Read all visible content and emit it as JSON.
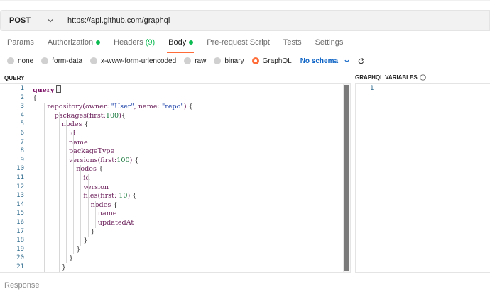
{
  "request": {
    "method": "POST",
    "url": "https://api.github.com/graphql"
  },
  "tabs": [
    {
      "label": "Params",
      "active": false,
      "dot": false,
      "count": ""
    },
    {
      "label": "Authorization",
      "active": false,
      "dot": true,
      "count": ""
    },
    {
      "label": "Headers",
      "active": false,
      "dot": false,
      "count": "(9)"
    },
    {
      "label": "Body",
      "active": true,
      "dot": true,
      "count": ""
    },
    {
      "label": "Pre-request Script",
      "active": false,
      "dot": false,
      "count": ""
    },
    {
      "label": "Tests",
      "active": false,
      "dot": false,
      "count": ""
    },
    {
      "label": "Settings",
      "active": false,
      "dot": false,
      "count": ""
    }
  ],
  "body_types": [
    {
      "label": "none",
      "selected": false
    },
    {
      "label": "form-data",
      "selected": false
    },
    {
      "label": "x-www-form-urlencoded",
      "selected": false
    },
    {
      "label": "raw",
      "selected": false
    },
    {
      "label": "binary",
      "selected": false
    },
    {
      "label": "GraphQL",
      "selected": true
    }
  ],
  "schema_label": "No schema",
  "query_panel": {
    "label": "QUERY",
    "lines": [
      {
        "n": "1",
        "indent": 0,
        "html": "<span class=\"kw\">query</span> <span class=\"caret-box\"></span>"
      },
      {
        "n": "2",
        "indent": 0,
        "html": "<span class=\"punct\">{</span>"
      },
      {
        "n": "3",
        "indent": 2,
        "html": "repository(owner: <span class=\"str\">\"User\"</span>, name: <span class=\"str\">\"repo\"</span>) <span class=\"punct\">{</span>"
      },
      {
        "n": "4",
        "indent": 3,
        "html": "packages(first:<span class=\"num\">100</span>)<span class=\"punct\">{</span>"
      },
      {
        "n": "5",
        "indent": 4,
        "html": "nodes <span class=\"punct\">{</span>"
      },
      {
        "n": "6",
        "indent": 5,
        "html": "id"
      },
      {
        "n": "7",
        "indent": 5,
        "html": "name"
      },
      {
        "n": "8",
        "indent": 5,
        "html": "packageType"
      },
      {
        "n": "9",
        "indent": 5,
        "html": "versions(first:<span class=\"num\">100</span>) <span class=\"punct\">{</span>"
      },
      {
        "n": "10",
        "indent": 6,
        "html": "nodes <span class=\"punct\">{</span>"
      },
      {
        "n": "11",
        "indent": 7,
        "html": "id"
      },
      {
        "n": "12",
        "indent": 7,
        "html": "version"
      },
      {
        "n": "13",
        "indent": 7,
        "html": "files(first: <span class=\"num\">10</span>) <span class=\"punct\">{</span>"
      },
      {
        "n": "14",
        "indent": 8,
        "html": "nodes <span class=\"punct\">{</span>"
      },
      {
        "n": "15",
        "indent": 9,
        "html": "name"
      },
      {
        "n": "16",
        "indent": 9,
        "html": "updatedAt"
      },
      {
        "n": "17",
        "indent": 8,
        "html": "<span class=\"punct\">}</span>"
      },
      {
        "n": "18",
        "indent": 7,
        "html": "<span class=\"punct\">}</span>"
      },
      {
        "n": "19",
        "indent": 6,
        "html": "<span class=\"punct\">}</span>"
      },
      {
        "n": "20",
        "indent": 5,
        "html": "<span class=\"punct\">}</span>"
      },
      {
        "n": "21",
        "indent": 4,
        "html": "<span class=\"punct\">}</span>"
      },
      {
        "n": "",
        "indent": 3,
        "html": "<span class=\"punct\">}</span>"
      }
    ]
  },
  "variables_panel": {
    "label": "GRAPHQL VARIABLES",
    "lines": [
      "1"
    ]
  },
  "response_label": "Response"
}
